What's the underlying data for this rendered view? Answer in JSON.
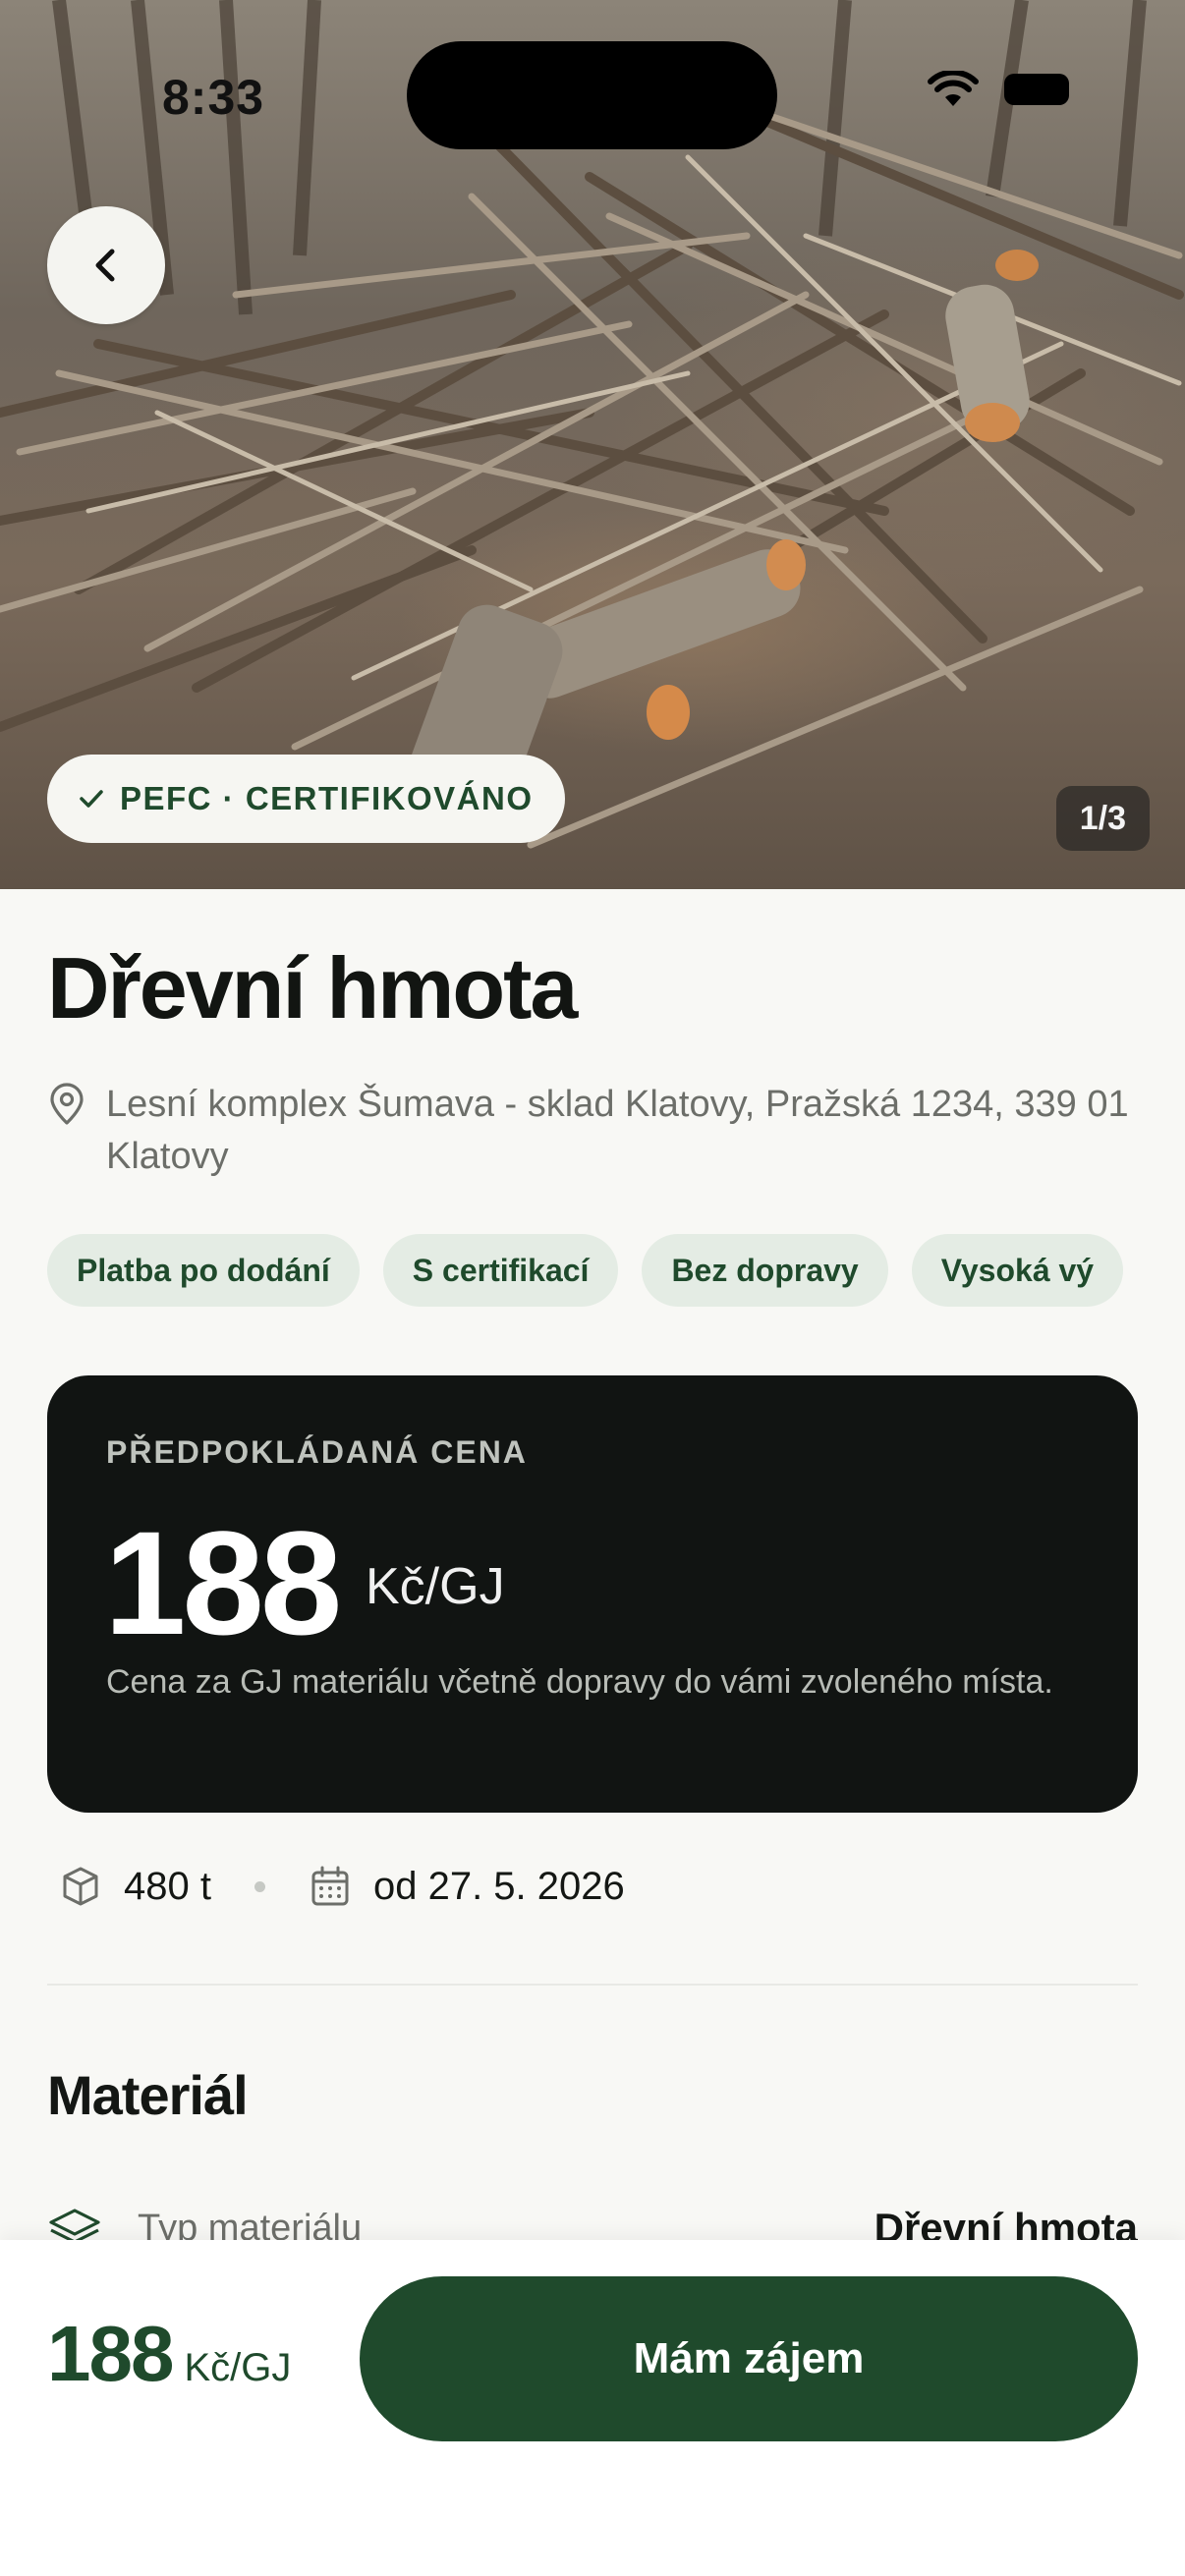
{
  "status_bar": {
    "time": "8:33"
  },
  "hero": {
    "certification_badge": "PEFC · CERTIFIKOVÁNO",
    "photo_counter": "1/3"
  },
  "listing": {
    "title": "Dřevní hmota",
    "location": "Lesní komplex Šumava - sklad Klatovy, Pražská 1234, 339 01 Klatovy",
    "tags": [
      "Platba po dodání",
      "S certifikací",
      "Bez dopravy",
      "Vysoká vý"
    ]
  },
  "price_card": {
    "label": "PŘEDPOKLÁDANÁ CENA",
    "value": "188",
    "unit": "Kč/GJ",
    "note": "Cena za GJ materiálu včetně dopravy do vámi zvoleného místa."
  },
  "meta": {
    "quantity": "480 t",
    "availability": "od 27. 5. 2026"
  },
  "material_section": {
    "title": "Materiál",
    "rows": [
      {
        "label": "Typ materiálu",
        "value": "Dřevní hmota"
      }
    ]
  },
  "bottom_bar": {
    "price_value": "188",
    "price_unit": "Kč/GJ",
    "cta_label": "Mám zájem"
  },
  "colors": {
    "accent_green": "#1f4a2c",
    "chip_bg": "#e4ece4",
    "card_dark": "#111412",
    "page_bg": "#f8f8f5"
  }
}
